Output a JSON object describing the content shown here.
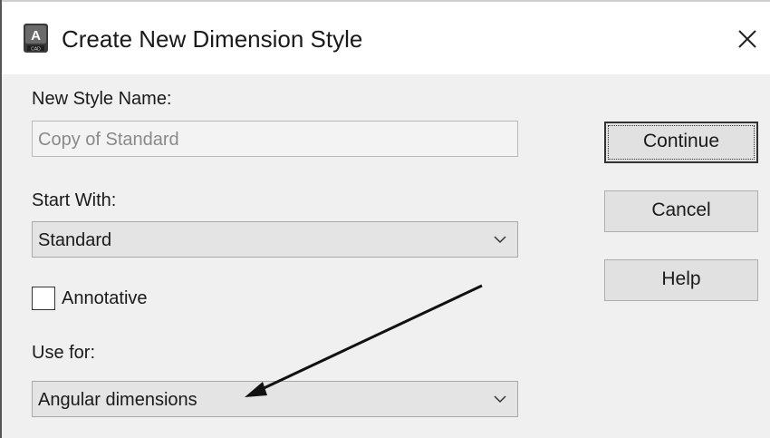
{
  "window": {
    "title": "Create New Dimension Style",
    "app_icon": "autocad-app-icon",
    "close_icon": "close-icon"
  },
  "form": {
    "new_style_name_label": "New Style Name:",
    "new_style_name_value": "Copy of Standard",
    "start_with_label": "Start With:",
    "start_with_value": "Standard",
    "annotative_label": "Annotative",
    "annotative_checked": false,
    "use_for_label": "Use for:",
    "use_for_value": "Angular dimensions"
  },
  "buttons": {
    "continue": "Continue",
    "cancel": "Cancel",
    "help": "Help"
  },
  "annotation": {
    "arrow_icon": "pointer-arrow",
    "color": "#111111"
  }
}
